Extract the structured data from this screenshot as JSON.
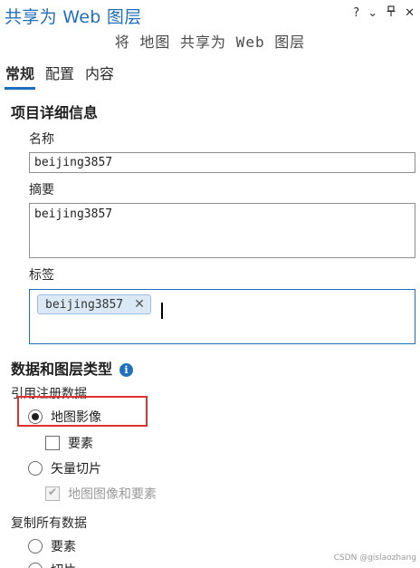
{
  "pane": {
    "title": "共享为 Web 图层",
    "controls": {
      "help": "?",
      "menu": "⌄",
      "pin": "📌",
      "close": "✕"
    }
  },
  "subtitle": "将 地图 共享为 Web 图层",
  "tabs": [
    {
      "label": "常规",
      "active": true
    },
    {
      "label": "配置",
      "active": false
    },
    {
      "label": "内容",
      "active": false
    }
  ],
  "item_details": {
    "heading": "项目详细信息",
    "name_label": "名称",
    "name_value": "beijing3857",
    "summary_label": "摘要",
    "summary_value": "beijing3857",
    "tags_label": "标签",
    "tags": [
      {
        "text": "beijing3857",
        "remove": "✕"
      }
    ]
  },
  "data_layer_type": {
    "heading": "数据和图层类型",
    "info_glyph": "i",
    "reference_label": "引用注册数据",
    "options": {
      "map_image": {
        "label": "地图影像",
        "checked": true
      },
      "features": {
        "label": "要素",
        "checked": false
      },
      "vector_tile": {
        "label": "矢量切片",
        "checked": false
      },
      "map_image_and_features": {
        "label": "地图图像和要素",
        "checked": true,
        "disabled": true
      }
    },
    "copy_label": "复制所有数据",
    "copy_options": {
      "features": {
        "label": "要素",
        "checked": false
      },
      "tile": {
        "label": "切片",
        "checked": false
      }
    }
  },
  "watermark": "CSDN @gislaozhang",
  "colors": {
    "accent": "#1f6fbf",
    "highlight": "#e03030"
  }
}
